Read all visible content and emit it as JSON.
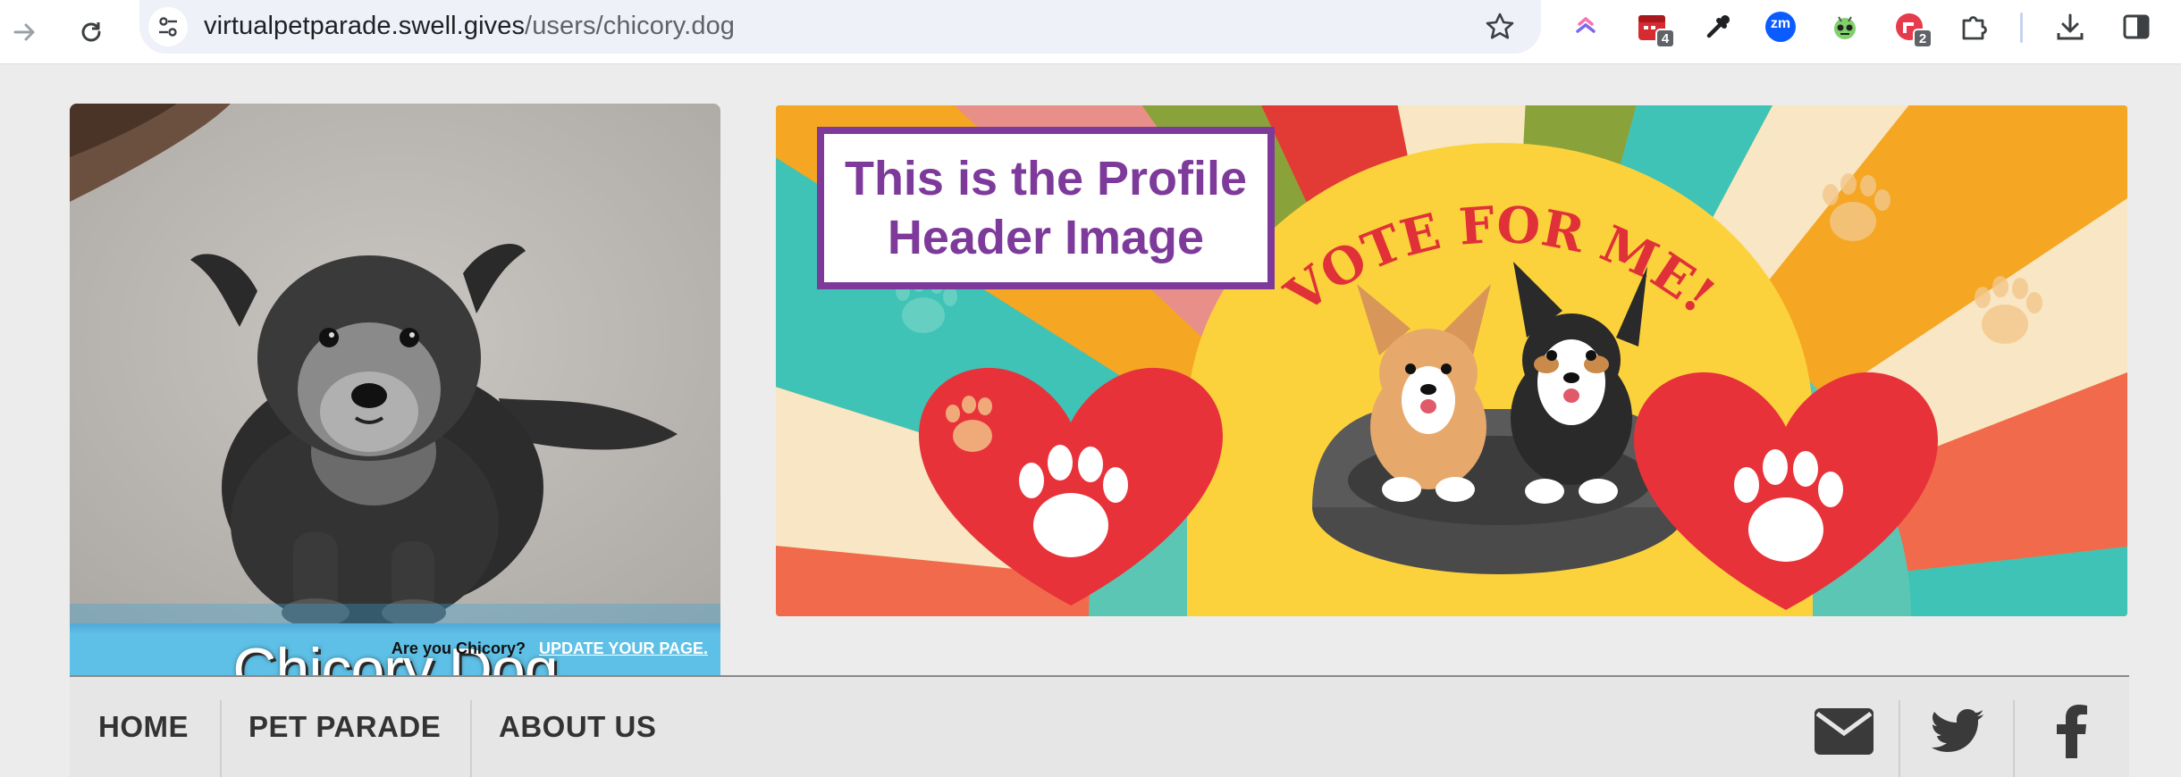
{
  "browser": {
    "url_domain": "virtualpetparade.swell.gives",
    "url_path": "/users/chicory.dog",
    "extensions": [
      {
        "name": "clickup-icon"
      },
      {
        "name": "calendar-extension-icon",
        "badge": "4"
      },
      {
        "name": "eyedropper-icon"
      },
      {
        "name": "zoom-extension-icon",
        "text": "zm"
      },
      {
        "name": "robot-extension-icon"
      },
      {
        "name": "red-extension-icon",
        "badge": "2"
      },
      {
        "name": "puzzle-icon"
      }
    ]
  },
  "profile": {
    "name": "Chicory Dog",
    "claim_prompt": "Are you Chicory?",
    "claim_link": "UPDATE YOUR PAGE."
  },
  "banner": {
    "callout": "This is the Profile\nHeader Image",
    "arc_text": "VOTE FOR ME!"
  },
  "nav": {
    "items": [
      "HOME",
      "PET PARADE",
      "ABOUT US"
    ],
    "social": [
      "envelope-icon",
      "twitter-icon",
      "facebook-icon"
    ]
  },
  "colors": {
    "accent_purple": "#7d3a9a",
    "claim_bar": "#5ec0e6",
    "heart_red": "#e8323a"
  }
}
